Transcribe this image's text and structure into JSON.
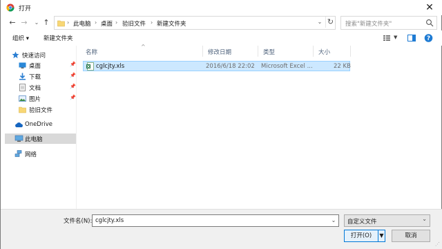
{
  "window": {
    "title": "打开"
  },
  "address": {
    "crumbs": [
      "此电脑",
      "桌面",
      "验旧文件",
      "新建文件夹"
    ]
  },
  "search": {
    "placeholder": "搜索\"新建文件夹\""
  },
  "toolbar": {
    "organize_label": "组织 ▾",
    "new_folder_label": "新建文件夹"
  },
  "sidebar": {
    "items": [
      {
        "label": "快速访问",
        "icon": "star-icon"
      },
      {
        "label": "桌面",
        "icon": "desktop-icon"
      },
      {
        "label": "下载",
        "icon": "download-icon"
      },
      {
        "label": "文档",
        "icon": "document-icon"
      },
      {
        "label": "图片",
        "icon": "pictures-icon"
      },
      {
        "label": "验旧文件",
        "icon": "folder-icon"
      },
      {
        "label": "OneDrive",
        "icon": "cloud-icon"
      },
      {
        "label": "此电脑",
        "icon": "computer-icon"
      },
      {
        "label": "网络",
        "icon": "network-icon"
      }
    ]
  },
  "columns": {
    "name": "名称",
    "modified": "修改日期",
    "type": "类型",
    "size": "大小"
  },
  "files": [
    {
      "name": "cglcjty.xls",
      "modified": "2016/6/18 22:02",
      "type": "Microsoft Excel ...",
      "size": "22 KB"
    }
  ],
  "footer": {
    "filename_label": "文件名(N):",
    "filename_value": "cglcjty.xls",
    "filter_value": "自定义文件",
    "open_label": "打开(O)",
    "cancel_label": "取消"
  },
  "colors": {
    "selection": "#cce8ff",
    "selection_border": "#99d1ff",
    "accent": "#0078d7"
  }
}
